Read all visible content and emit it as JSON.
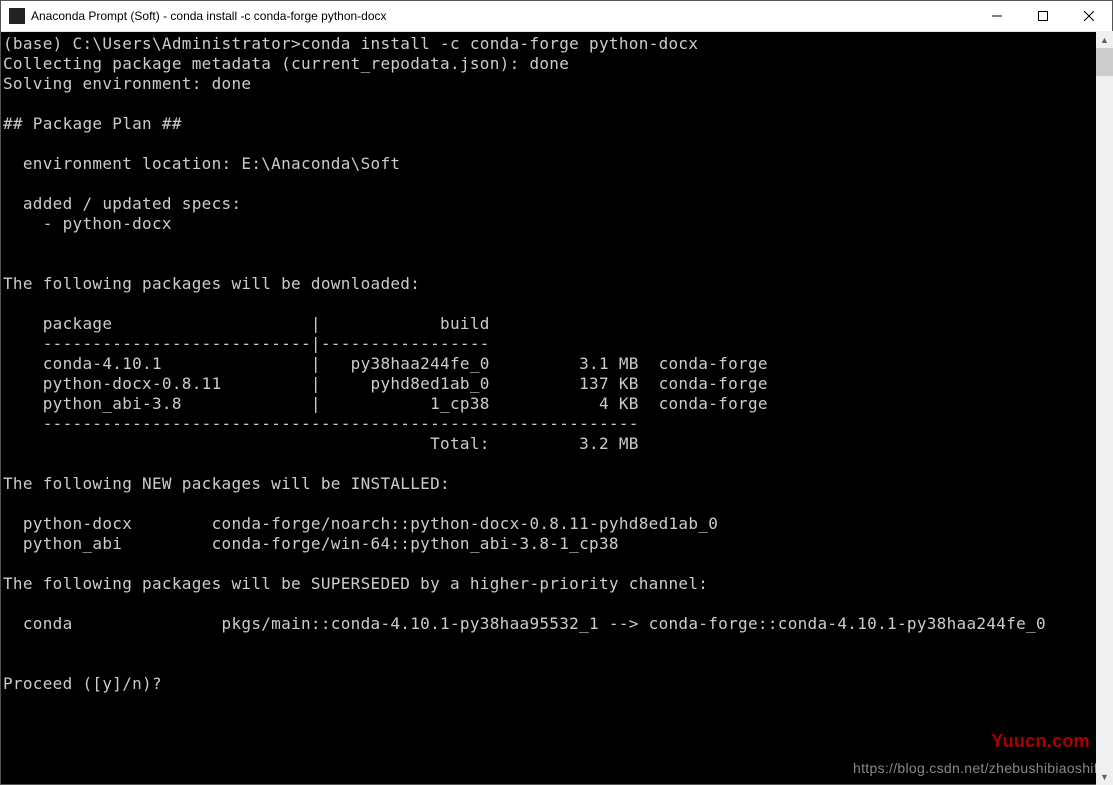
{
  "titlebar": {
    "title": "Anaconda Prompt (Soft) - conda  install -c conda-forge python-docx"
  },
  "prompt": {
    "prefix": "(base) C:\\Users\\Administrator>",
    "command": "conda install -c conda-forge python-docx"
  },
  "lines": {
    "collecting": "Collecting package metadata (current_repodata.json): done",
    "solving": "Solving environment: done",
    "plan_header": "## Package Plan ##",
    "env_location": "  environment location: E:\\Anaconda\\Soft",
    "added_specs": "  added / updated specs:",
    "spec1": "    - python-docx",
    "dl_header": "The following packages will be downloaded:",
    "tbl_header": "    package                    |            build",
    "tbl_sep": "    ---------------------------|-----------------",
    "tbl_row1": "    conda-4.10.1               |   py38haa244fe_0         3.1 MB  conda-forge",
    "tbl_row2": "    python-docx-0.8.11         |     pyhd8ed1ab_0         137 KB  conda-forge",
    "tbl_row3": "    python_abi-3.8             |           1_cp38           4 KB  conda-forge",
    "tbl_sep2": "    ------------------------------------------------------------",
    "tbl_total": "                                           Total:         3.2 MB",
    "new_header": "The following NEW packages will be INSTALLED:",
    "new1": "  python-docx        conda-forge/noarch::python-docx-0.8.11-pyhd8ed1ab_0",
    "new2": "  python_abi         conda-forge/win-64::python_abi-3.8-1_cp38",
    "sup_header": "The following packages will be SUPERSEDED by a higher-priority channel:",
    "sup1": "  conda               pkgs/main::conda-4.10.1-py38haa95532_1 --> conda-forge::conda-4.10.1-py38haa244fe_0",
    "proceed": "Proceed ([y]/n)? "
  },
  "downloads": [
    {
      "package": "conda-4.10.1",
      "build": "py38haa244fe_0",
      "size": "3.1 MB",
      "channel": "conda-forge"
    },
    {
      "package": "python-docx-0.8.11",
      "build": "pyhd8ed1ab_0",
      "size": "137 KB",
      "channel": "conda-forge"
    },
    {
      "package": "python_abi-3.8",
      "build": "1_cp38",
      "size": "4 KB",
      "channel": "conda-forge"
    }
  ],
  "downloads_total": "3.2 MB",
  "new_packages": [
    {
      "name": "python-docx",
      "spec": "conda-forge/noarch::python-docx-0.8.11-pyhd8ed1ab_0"
    },
    {
      "name": "python_abi",
      "spec": "conda-forge/win-64::python_abi-3.8-1_cp38"
    }
  ],
  "superseded": [
    {
      "name": "conda",
      "from": "pkgs/main::conda-4.10.1-py38haa95532_1",
      "to": "conda-forge::conda-4.10.1-py38haa244fe_0"
    }
  ],
  "watermarks": {
    "brand": "Yuucn.com",
    "url": "https://blog.csdn.net/zhebushibiaoshifu"
  }
}
